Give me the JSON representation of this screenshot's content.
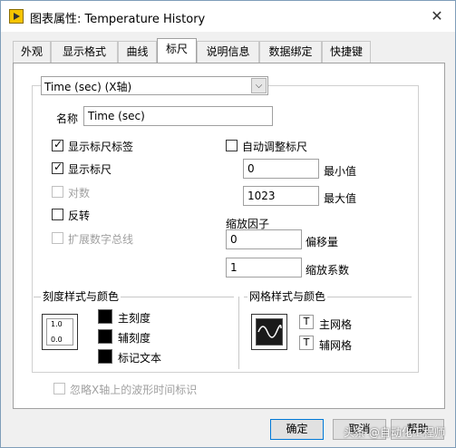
{
  "window": {
    "title": "图表属性: Temperature History",
    "close_glyph": "✕"
  },
  "tabs": [
    {
      "label": "外观"
    },
    {
      "label": "显示格式"
    },
    {
      "label": "曲线"
    },
    {
      "label": "标尺"
    },
    {
      "label": "说明信息"
    },
    {
      "label": "数据绑定"
    },
    {
      "label": "快捷键"
    }
  ],
  "active_tab": "标尺",
  "axis_select": {
    "value": "Time (sec)   (X轴)",
    "arrow": "⌵"
  },
  "name_field": {
    "label": "名称",
    "value": "Time (sec)"
  },
  "checks": {
    "show_scale_label": {
      "label": "显示标尺标签",
      "checked": true
    },
    "show_scale": {
      "label": "显示标尺",
      "checked": true
    },
    "log": {
      "label": "对数",
      "checked": false,
      "disabled": true
    },
    "invert": {
      "label": "反转",
      "checked": false
    },
    "expand_digital": {
      "label": "扩展数字总线",
      "checked": false,
      "disabled": true
    },
    "autoscale": {
      "label": "自动调整标尺",
      "checked": false
    },
    "ignore_waveform_time": {
      "label": "忽略X轴上的波形时间标识",
      "checked": false,
      "disabled": true
    }
  },
  "range": {
    "min_value": "0",
    "min_label": "最小值",
    "max_value": "1023",
    "max_label": "最大值"
  },
  "scaling": {
    "title": "缩放因子",
    "offset_value": "0",
    "offset_label": "偏移量",
    "multiplier_value": "1",
    "multiplier_label": "缩放系数"
  },
  "scale_style": {
    "title": "刻度样式与颜色",
    "icon_top": "1.0",
    "icon_bottom": "0.0",
    "major_label": "主刻度",
    "minor_label": "辅刻度",
    "marker_label": "标记文本"
  },
  "grid_style": {
    "title": "网格样式与颜色",
    "major_label": "主网格",
    "minor_label": "辅网格",
    "swatch_glyph": "T"
  },
  "buttons": {
    "ok": "确定",
    "cancel": "取消",
    "help": "帮助"
  },
  "watermark": "头条 @自动化工程师",
  "colors": {
    "accent": "#0078d7",
    "panel_bg": "#ffffff",
    "dialog_bg": "#f0f0f0"
  }
}
